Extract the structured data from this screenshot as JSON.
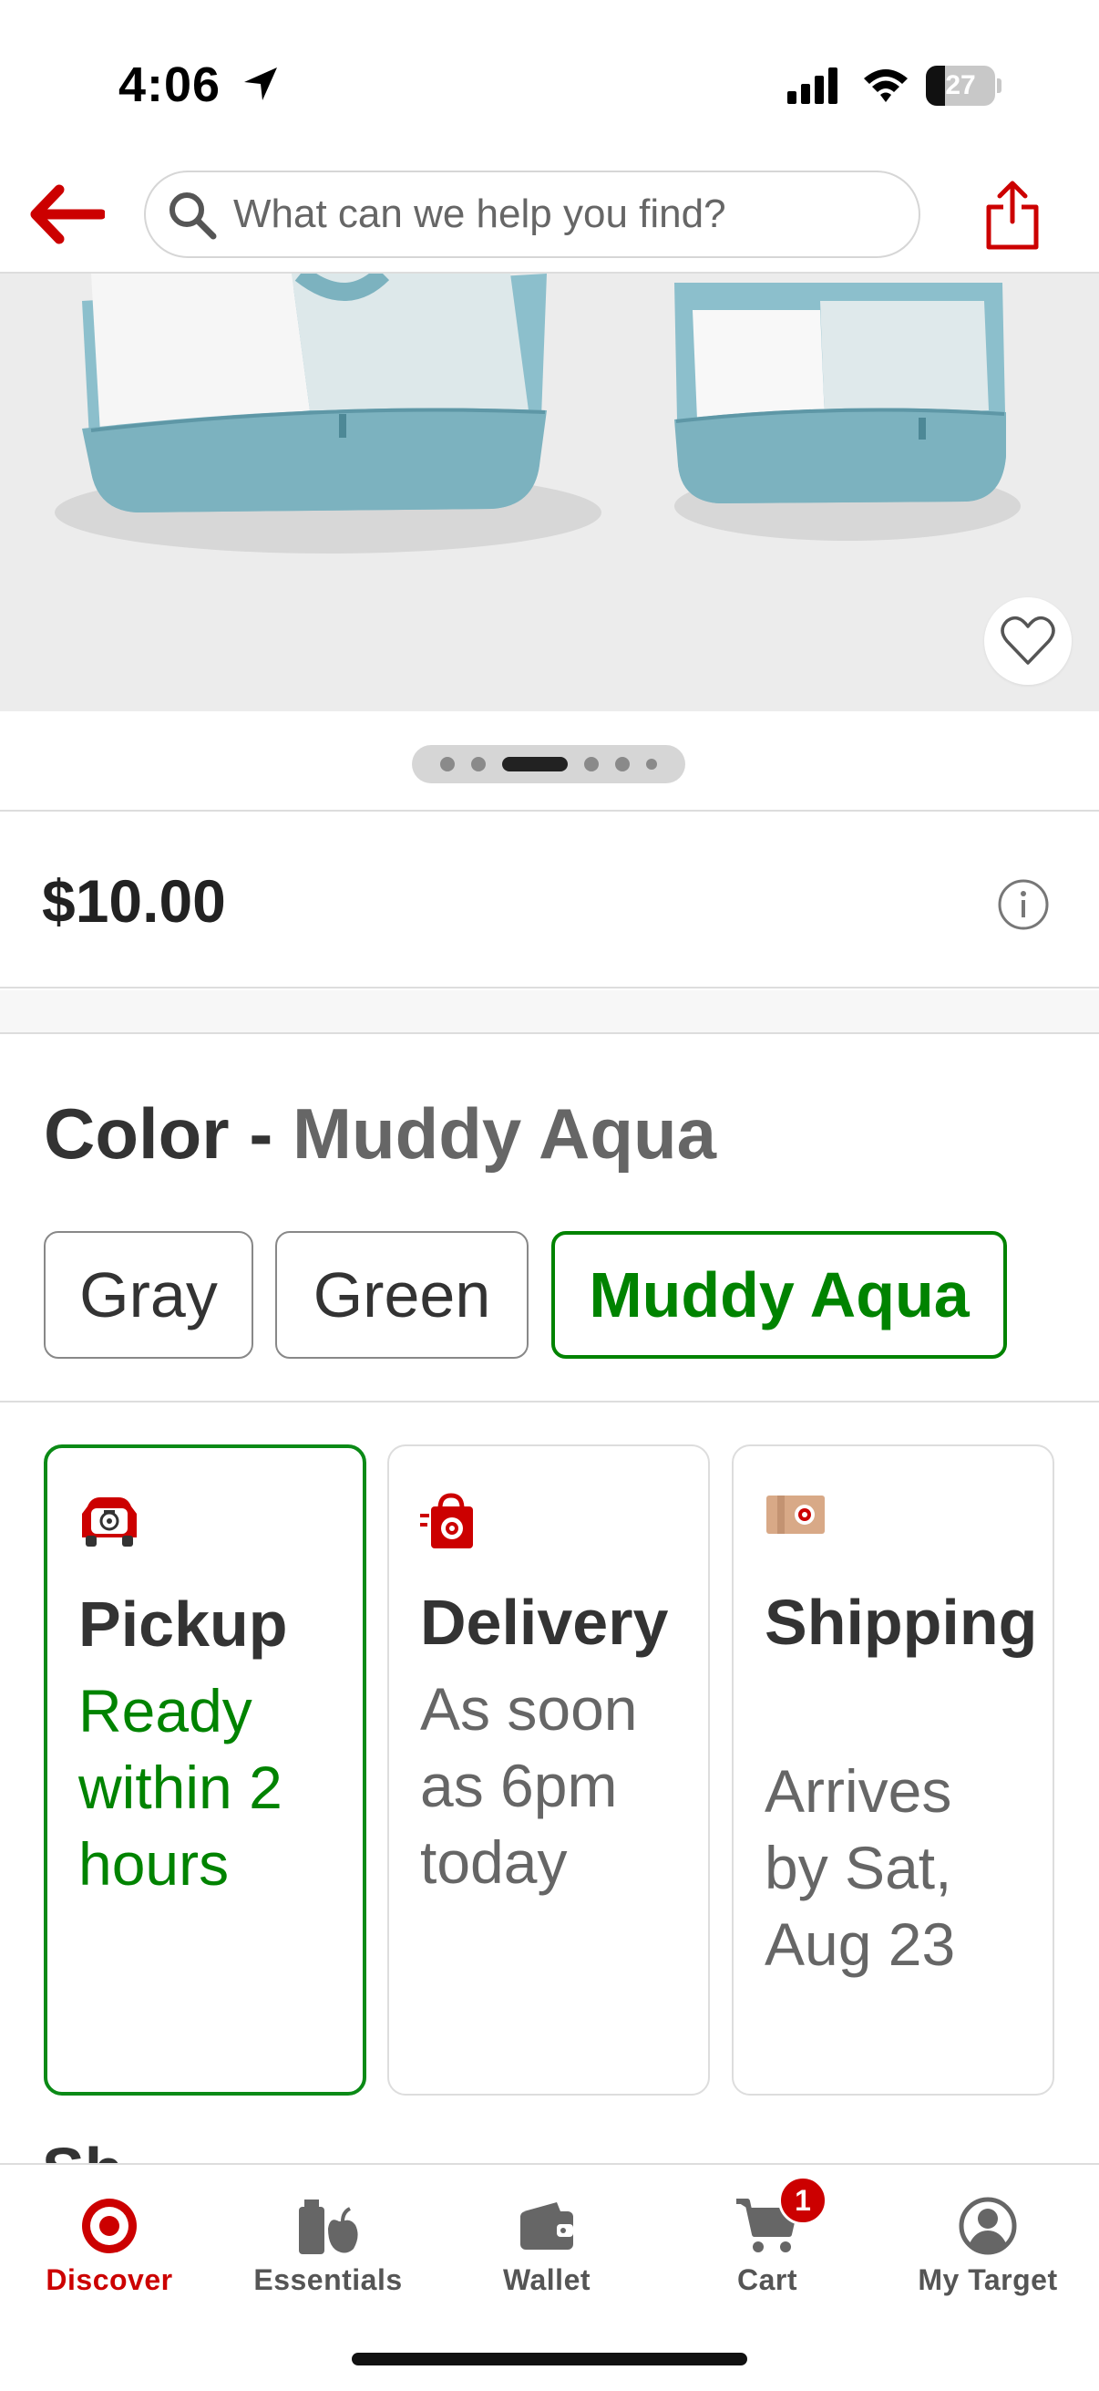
{
  "status_bar": {
    "time": "4:06",
    "battery": "27",
    "battery_level": 0.27
  },
  "header": {
    "search_placeholder": "What can we help you find?",
    "back_icon": "back-arrow-icon",
    "share_icon": "share-icon"
  },
  "gallery": {
    "image_count": 6,
    "active_index": 2
  },
  "product": {
    "price": "$10.00"
  },
  "color": {
    "heading": "Color",
    "separator": " - ",
    "selected": "Muddy Aqua",
    "options": [
      "Gray",
      "Green",
      "Muddy Aqua"
    ]
  },
  "fulfillment": [
    {
      "title": "Pickup",
      "subtitle": "Ready within 2 hours",
      "icon": "pickup-car-icon"
    },
    {
      "title": "Delivery",
      "subtitle": "As soon as 6pm today",
      "icon": "delivery-bag-icon"
    },
    {
      "title": "Shipping",
      "subtitle": "Arrives by Sat, Aug 23",
      "icon": "shipping-box-icon"
    }
  ],
  "next_section_partial": "Sh",
  "bottom_nav": {
    "items": [
      {
        "label": "Discover",
        "icon": "target-logo-icon"
      },
      {
        "label": "Essentials",
        "icon": "essentials-icon"
      },
      {
        "label": "Wallet",
        "icon": "wallet-icon"
      },
      {
        "label": "Cart",
        "icon": "cart-icon"
      },
      {
        "label": "My Target",
        "icon": "account-icon"
      }
    ],
    "cart_count": "1"
  },
  "colors": {
    "brand_red": "#cc0000",
    "selected_green": "#008300",
    "product_aqua": "#8cc0cc"
  }
}
